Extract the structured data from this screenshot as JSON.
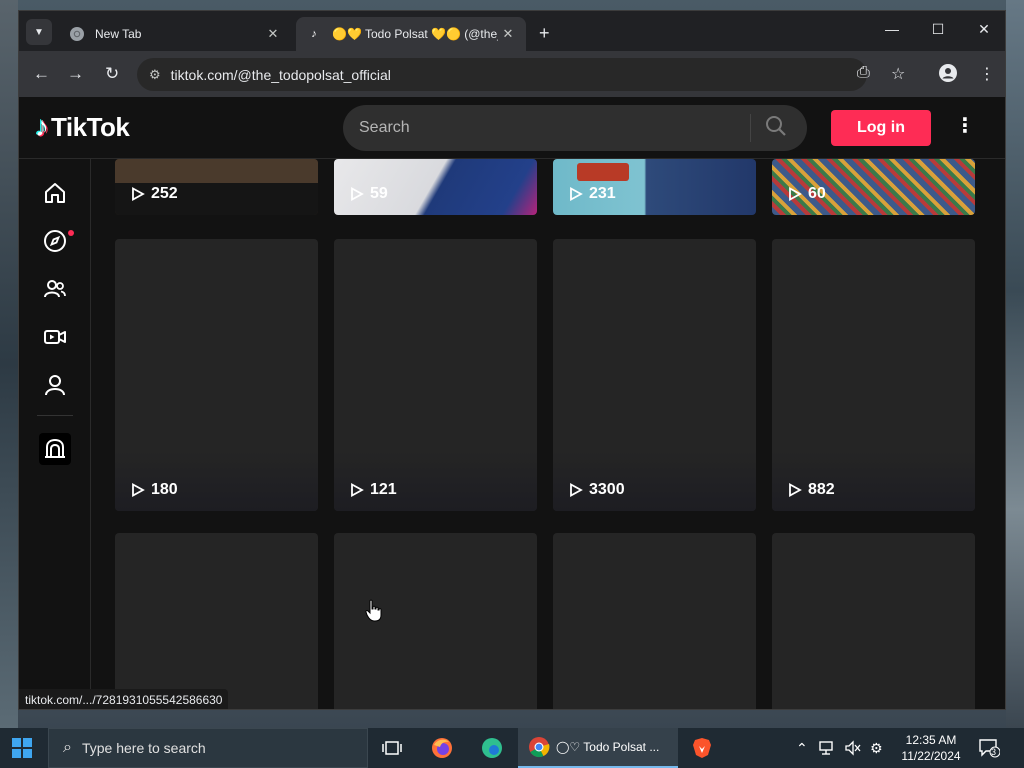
{
  "browser": {
    "tabs": [
      {
        "title": "New Tab",
        "favicon": "chrome-icon",
        "active": false
      },
      {
        "title": "🟡💛 Todo Polsat 💛🟡 (@the_todopolsat_official",
        "favicon": "tiktok-icon",
        "active": true
      }
    ],
    "url": "tiktok.com/@the_todopolsat_official",
    "status_url": "tiktok.com/.../7281931055542586630"
  },
  "tiktok": {
    "brand": "TikTok",
    "search_placeholder": "Search",
    "login_label": "Log in",
    "sidebar": [
      {
        "name": "home-icon"
      },
      {
        "name": "explore-icon",
        "notification": true
      },
      {
        "name": "following-icon"
      },
      {
        "name": "live-icon"
      },
      {
        "name": "profile-icon"
      },
      {
        "name": "more-icon"
      }
    ],
    "videos": [
      {
        "views": "252"
      },
      {
        "views": "59"
      },
      {
        "views": "231"
      },
      {
        "views": "60"
      },
      {
        "views": "180"
      },
      {
        "views": "121"
      },
      {
        "views": "3300"
      },
      {
        "views": "882"
      },
      {
        "views": ""
      },
      {
        "views": ""
      },
      {
        "views": ""
      },
      {
        "views": ""
      }
    ]
  },
  "taskbar": {
    "search_placeholder": "Type here to search",
    "chrome_label": "◯♡ Todo Polsat ...",
    "time": "12:35 AM",
    "date": "11/22/2024",
    "notifications": "3"
  },
  "colors": {
    "accent": "#fe2c55",
    "page_bg": "#121212",
    "card_bg": "#252525"
  }
}
